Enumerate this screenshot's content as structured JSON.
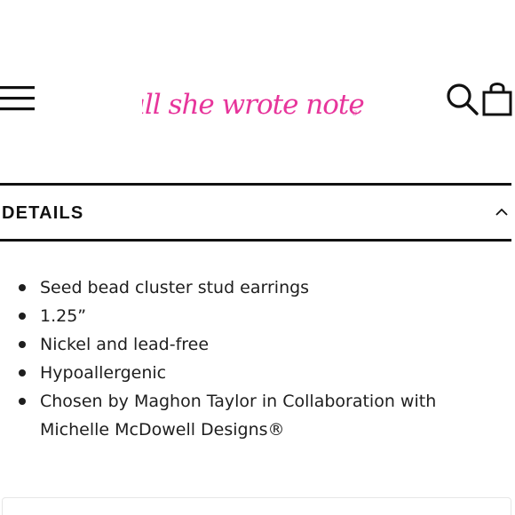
{
  "header": {
    "brand_name": "all she wrote notes",
    "menu_icon": "hamburger-menu-icon",
    "search_icon": "search-icon",
    "cart_icon": "shopping-bag-icon",
    "brand_color": "#e7359b"
  },
  "details": {
    "title": "DETAILS",
    "expanded": true,
    "toggle_icon": "chevron-up-icon",
    "items": [
      "Seed bead cluster stud earrings",
      "1.25”",
      "Nickel and lead-free",
      "Hypoallergenic",
      "Chosen by Maghon Taylor in Collaboration with Michelle McDowell Designs®"
    ]
  }
}
